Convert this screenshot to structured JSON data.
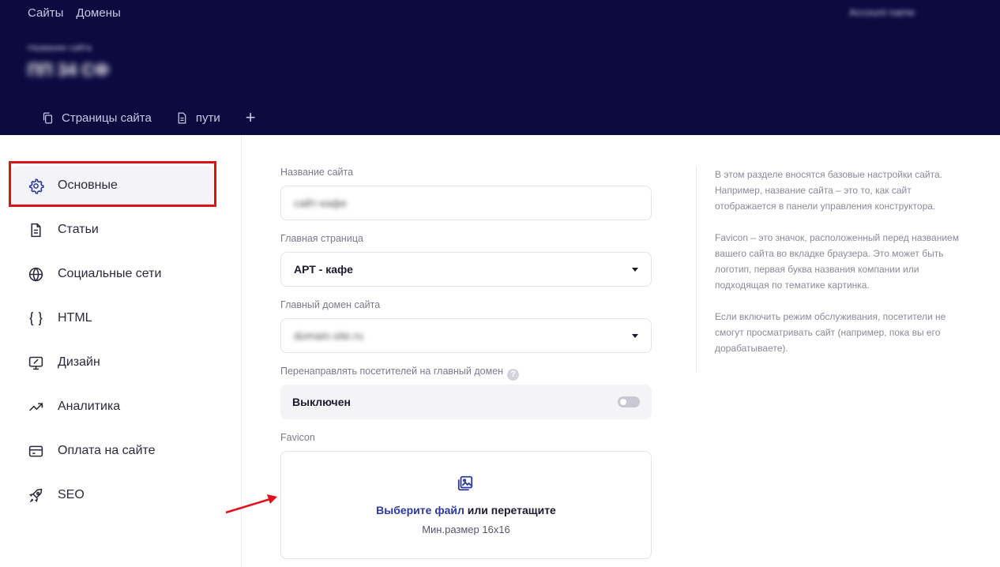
{
  "header": {
    "nav": [
      "Сайты",
      "Домены"
    ],
    "account": "Account name",
    "site_subtitle": "Название сайта",
    "site_title": "ПП 34 СФ",
    "tabs": [
      {
        "label": "Страницы сайта",
        "icon": "copy-pages-icon"
      },
      {
        "label": "пути",
        "icon": "document-icon"
      }
    ],
    "add_tab": "+"
  },
  "sidebar": {
    "items": [
      {
        "label": "Основные",
        "icon": "gear-icon",
        "active": true
      },
      {
        "label": "Статьи",
        "icon": "article-icon"
      },
      {
        "label": "Социальные сети",
        "icon": "globe-icon"
      },
      {
        "label": "HTML",
        "icon": "braces-icon"
      },
      {
        "label": "Дизайн",
        "icon": "monitor-brush-icon"
      },
      {
        "label": "Аналитика",
        "icon": "trend-icon"
      },
      {
        "label": "Оплата на сайте",
        "icon": "credit-card-icon"
      },
      {
        "label": "SEO",
        "icon": "rocket-icon"
      }
    ]
  },
  "form": {
    "site_name": {
      "label": "Название сайта",
      "value": "сайт-кафе"
    },
    "main_page": {
      "label": "Главная страница",
      "value": "АРТ - кафе"
    },
    "main_domain": {
      "label": "Главный домен сайта",
      "value": "domain.site.ru"
    },
    "redirect": {
      "label": "Перенаправлять посетителей на главный домен",
      "help": "?",
      "state_label": "Выключен",
      "enabled": false
    },
    "favicon": {
      "label": "Favicon",
      "choose_link": "Выберите файл",
      "or_drag": " или перетащите",
      "hint": "Мин.размер 16x16",
      "icon": "image-upload-icon"
    }
  },
  "help": {
    "paragraphs": [
      "В этом разделе вносятся базовые настройки сайта. Например, название сайта – это то, как сайт отображается в панели управления конструктора.",
      "Favicon – это значок, расположенный перед названием вашего сайта во вкладке браузера. Это может быть логотип, первая буква названия компании или подходящая по тематике картинка.",
      "Если включить режим обслуживания, посетители не смогут просматривать сайт (например, пока вы его дорабатываете)."
    ]
  },
  "colors": {
    "header_bg": "#0c0a3e",
    "accent": "#2b3a9c",
    "highlight": "#e0101a"
  }
}
